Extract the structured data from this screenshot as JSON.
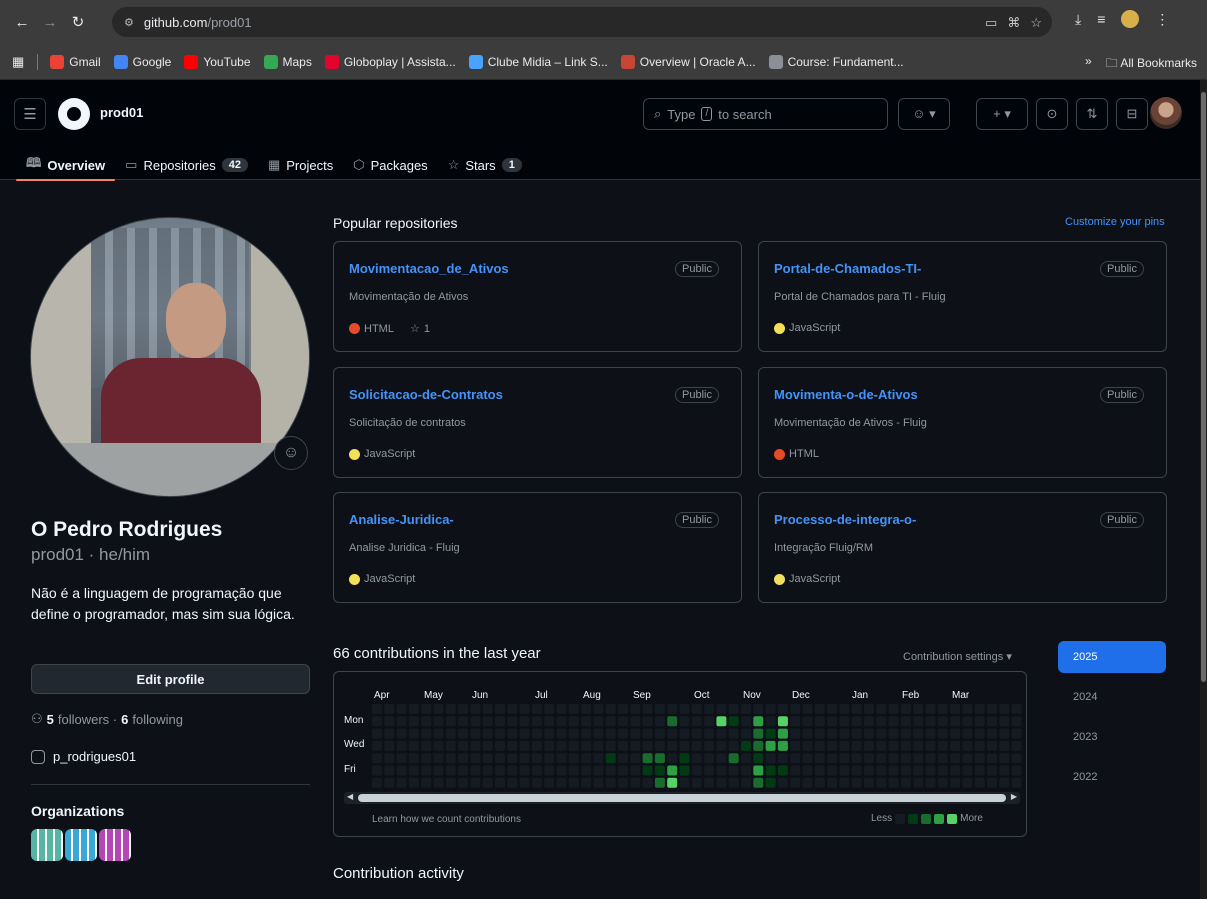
{
  "browser": {
    "url_host": "github.com",
    "url_path": "/prod01",
    "bookmarks": [
      {
        "label": "Gmail",
        "color": "#ea4335"
      },
      {
        "label": "Google",
        "color": "#4285f4"
      },
      {
        "label": "YouTube",
        "color": "#ff0000"
      },
      {
        "label": "Maps",
        "color": "#34a853"
      },
      {
        "label": "Globoplay | Assista...",
        "color": "#e4032e"
      },
      {
        "label": "Clube Midia – Link S...",
        "color": "#4aa3ff"
      },
      {
        "label": "Overview | Oracle A...",
        "color": "#c74634"
      },
      {
        "label": "Course: Fundament...",
        "color": "#8a8f98"
      }
    ],
    "more_bookmarks": "»",
    "all_bookmarks": "All Bookmarks"
  },
  "header": {
    "username": "prod01",
    "search_placeholder_prefix": "Type",
    "search_key": "/",
    "search_placeholder_suffix": "to search",
    "tabs": [
      {
        "label": "Overview",
        "icon": "book-icon",
        "glyph": "🕮",
        "count": ""
      },
      {
        "label": "Repositories",
        "icon": "repo-icon",
        "glyph": "▭",
        "count": "42"
      },
      {
        "label": "Projects",
        "icon": "table-icon",
        "glyph": "▦",
        "count": ""
      },
      {
        "label": "Packages",
        "icon": "package-icon",
        "glyph": "⬡",
        "count": ""
      },
      {
        "label": "Stars",
        "icon": "star-icon",
        "glyph": "☆",
        "count": "1"
      }
    ]
  },
  "profile": {
    "name": "O Pedro Rodrigues",
    "login": "prod01 · he/him",
    "bio": "Não é a linguagem de programação que define o programador, mas sim sua lógica.",
    "edit_button": "Edit profile",
    "followers_count": "5",
    "followers_label": "followers ·",
    "following_count": "6",
    "following_label": "following",
    "social": "p_rodrigues01",
    "organizations_title": "Organizations",
    "organizations": [
      {
        "icon": "org-icon-1",
        "color": "#56b5a3"
      },
      {
        "icon": "org-icon-2",
        "color": "#3ba6d8"
      },
      {
        "icon": "org-icon-3",
        "color": "#b646b8"
      }
    ]
  },
  "popular": {
    "title": "Popular repositories",
    "customize": "Customize your pins",
    "repos": [
      {
        "name": "Movimentacao_de_Ativos",
        "badge": "Public",
        "desc": "Movimentação de Ativos",
        "lang": "HTML",
        "lang_color": "#e34c26",
        "stars": "1"
      },
      {
        "name": "Portal-de-Chamados-TI-",
        "badge": "Public",
        "desc": "Portal de Chamados para TI - Fluig",
        "lang": "JavaScript",
        "lang_color": "#f1e05a",
        "stars": ""
      },
      {
        "name": "Solicitacao-de-Contratos",
        "badge": "Public",
        "desc": "Solicitação de contratos",
        "lang": "JavaScript",
        "lang_color": "#f1e05a",
        "stars": ""
      },
      {
        "name": "Movimenta-o-de-Ativos",
        "badge": "Public",
        "desc": "Movimentação de Ativos - Fluig",
        "lang": "HTML",
        "lang_color": "#e34c26",
        "stars": ""
      },
      {
        "name": "Analise-Juridica-",
        "badge": "Public",
        "desc": "Analise Juridica - Fluig",
        "lang": "JavaScript",
        "lang_color": "#f1e05a",
        "stars": ""
      },
      {
        "name": "Processo-de-integra-o-",
        "badge": "Public",
        "desc": "Integração Fluig/RM",
        "lang": "JavaScript",
        "lang_color": "#f1e05a",
        "stars": ""
      }
    ]
  },
  "contributions": {
    "title": "66 contributions in the last year",
    "settings": "Contribution settings",
    "months": [
      "Apr",
      "May",
      "Jun",
      "Jul",
      "Aug",
      "Sep",
      "Oct",
      "Nov",
      "Dec",
      "Jan",
      "Feb",
      "Mar"
    ],
    "days": [
      "Mon",
      "Wed",
      "Fri"
    ],
    "learn": "Learn how we count contributions",
    "less": "Less",
    "more": "More",
    "levels": [
      "#151b23",
      "#033a16",
      "#196c2e",
      "#2ea043",
      "#56d364"
    ],
    "active_cells": [
      {
        "week": 24,
        "day": 1,
        "level": 2
      },
      {
        "week": 28,
        "day": 1,
        "level": 4
      },
      {
        "week": 29,
        "day": 1,
        "level": 1
      },
      {
        "week": 31,
        "day": 1,
        "level": 3
      },
      {
        "week": 33,
        "day": 1,
        "level": 4
      },
      {
        "week": 31,
        "day": 2,
        "level": 2
      },
      {
        "week": 32,
        "day": 2,
        "level": 1
      },
      {
        "week": 33,
        "day": 2,
        "level": 3
      },
      {
        "week": 30,
        "day": 3,
        "level": 1
      },
      {
        "week": 31,
        "day": 3,
        "level": 2
      },
      {
        "week": 32,
        "day": 3,
        "level": 3
      },
      {
        "week": 33,
        "day": 3,
        "level": 3
      },
      {
        "week": 19,
        "day": 4,
        "level": 1
      },
      {
        "week": 22,
        "day": 4,
        "level": 2
      },
      {
        "week": 23,
        "day": 4,
        "level": 2
      },
      {
        "week": 25,
        "day": 4,
        "level": 1
      },
      {
        "week": 29,
        "day": 4,
        "level": 2
      },
      {
        "week": 31,
        "day": 4,
        "level": 1
      },
      {
        "week": 22,
        "day": 5,
        "level": 1
      },
      {
        "week": 23,
        "day": 5,
        "level": 1
      },
      {
        "week": 24,
        "day": 5,
        "level": 2
      },
      {
        "week": 25,
        "day": 5,
        "level": 1
      },
      {
        "week": 24,
        "day": 5,
        "level": 3
      },
      {
        "week": 31,
        "day": 5,
        "level": 3
      },
      {
        "week": 32,
        "day": 5,
        "level": 1
      },
      {
        "week": 33,
        "day": 5,
        "level": 1
      },
      {
        "week": 23,
        "day": 6,
        "level": 2
      },
      {
        "week": 24,
        "day": 6,
        "level": 4
      },
      {
        "week": 31,
        "day": 6,
        "level": 2
      },
      {
        "week": 32,
        "day": 6,
        "level": 1
      }
    ],
    "years": [
      "2025",
      "2024",
      "2023",
      "2022"
    ],
    "active_year": "2025"
  },
  "activity": {
    "title": "Contribution activity"
  }
}
